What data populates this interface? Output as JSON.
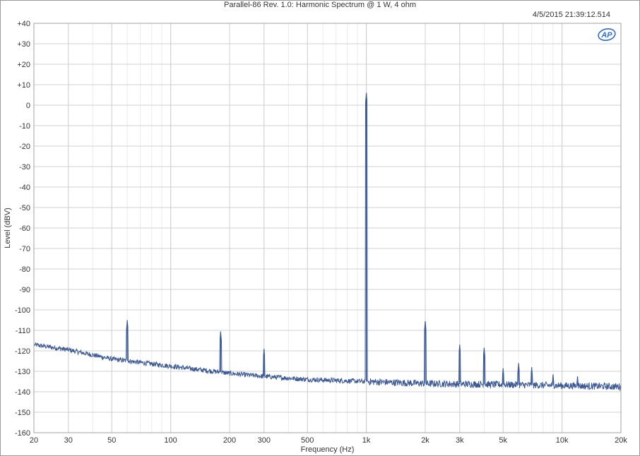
{
  "window": {
    "title": "Parallel-86 Rev. 1.0: Harmonic Spectrum @ 1 W, 4 ohm",
    "timestamp": "4/5/2015 21:39:12.514",
    "logo_text": "AP"
  },
  "colors": {
    "trace": "#3d5a96",
    "grid_major": "#d0d0d0",
    "grid_minor": "#ebebeb",
    "plot_border": "#a0a0a0",
    "logo": "#2d6fd1"
  },
  "chart_data": {
    "type": "line",
    "title": "Parallel-86 Rev. 1.0: Harmonic Spectrum @ 1 W, 4 ohm",
    "xlabel": "Frequency (Hz)",
    "ylabel": "Level (dBV)",
    "x_scale": "log",
    "xlim": [
      20,
      20000
    ],
    "ylim": [
      -160,
      40
    ],
    "grid": true,
    "x_ticks": [
      {
        "value": 20,
        "label": "20"
      },
      {
        "value": 30,
        "label": "30"
      },
      {
        "value": 50,
        "label": "50"
      },
      {
        "value": 100,
        "label": "100"
      },
      {
        "value": 200,
        "label": "200"
      },
      {
        "value": 300,
        "label": "300"
      },
      {
        "value": 500,
        "label": "500"
      },
      {
        "value": 1000,
        "label": "1k"
      },
      {
        "value": 2000,
        "label": "2k"
      },
      {
        "value": 3000,
        "label": "3k"
      },
      {
        "value": 5000,
        "label": "5k"
      },
      {
        "value": 10000,
        "label": "10k"
      },
      {
        "value": 20000,
        "label": "20k"
      }
    ],
    "y_ticks": [
      {
        "value": 40,
        "label": "+40"
      },
      {
        "value": 30,
        "label": "+30"
      },
      {
        "value": 20,
        "label": "+20"
      },
      {
        "value": 10,
        "label": "+10"
      },
      {
        "value": 0,
        "label": "0"
      },
      {
        "value": -10,
        "label": "-10"
      },
      {
        "value": -20,
        "label": "-20"
      },
      {
        "value": -30,
        "label": "-30"
      },
      {
        "value": -40,
        "label": "-40"
      },
      {
        "value": -50,
        "label": "-50"
      },
      {
        "value": -60,
        "label": "-60"
      },
      {
        "value": -70,
        "label": "-70"
      },
      {
        "value": -80,
        "label": "-80"
      },
      {
        "value": -90,
        "label": "-90"
      },
      {
        "value": -100,
        "label": "-100"
      },
      {
        "value": -110,
        "label": "-110"
      },
      {
        "value": -120,
        "label": "-120"
      },
      {
        "value": -130,
        "label": "-130"
      },
      {
        "value": -140,
        "label": "-140"
      },
      {
        "value": -150,
        "label": "-150"
      },
      {
        "value": -160,
        "label": "-160"
      }
    ],
    "noise_floor": [
      {
        "x": 20,
        "y": -117
      },
      {
        "x": 30,
        "y": -119.5
      },
      {
        "x": 50,
        "y": -124
      },
      {
        "x": 100,
        "y": -127.5
      },
      {
        "x": 200,
        "y": -131
      },
      {
        "x": 300,
        "y": -132.5
      },
      {
        "x": 500,
        "y": -134
      },
      {
        "x": 1000,
        "y": -135
      },
      {
        "x": 2000,
        "y": -136
      },
      {
        "x": 5000,
        "y": -136.5
      },
      {
        "x": 10000,
        "y": -137
      },
      {
        "x": 20000,
        "y": -137.5
      }
    ],
    "peaks": [
      {
        "x": 60,
        "y": -105
      },
      {
        "x": 180,
        "y": -110.5
      },
      {
        "x": 300,
        "y": -119
      },
      {
        "x": 1000,
        "y": 6
      },
      {
        "x": 2000,
        "y": -105.5
      },
      {
        "x": 3000,
        "y": -117
      },
      {
        "x": 4000,
        "y": -118.5
      },
      {
        "x": 5000,
        "y": -128.5
      },
      {
        "x": 6000,
        "y": -126
      },
      {
        "x": 7000,
        "y": -128
      },
      {
        "x": 9000,
        "y": -131.5
      },
      {
        "x": 12000,
        "y": -132.5
      }
    ]
  }
}
